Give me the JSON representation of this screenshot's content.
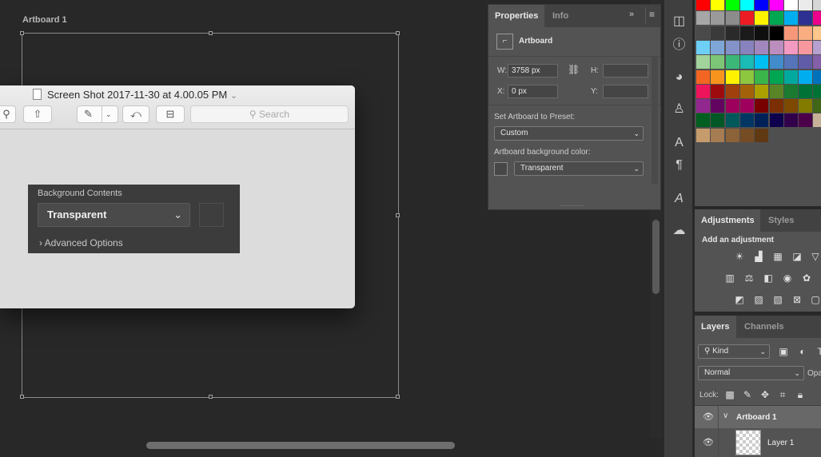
{
  "canvas": {
    "artboard_label": "Artboard 1",
    "bg_color": "#282828"
  },
  "preview_window": {
    "title": "Screen Shot 2017-11-30 at 4.00.05 PM",
    "title_chevron": "⌄",
    "search_placeholder": "Search",
    "toolbar_icons": [
      "zoom-icon",
      "share-icon",
      "markup-pen-icon",
      "chevron-down-icon",
      "rotate-icon",
      "toolbox-icon"
    ]
  },
  "background_popup": {
    "label": "Background Contents",
    "value": "Transparent",
    "advanced_label": "Advanced Options"
  },
  "properties": {
    "tabs": [
      "Properties",
      "Info"
    ],
    "section_title": "Artboard",
    "w_label": "W:",
    "w_value": "3758 px",
    "h_label": "H:",
    "h_value": "",
    "x_label": "X:",
    "x_value": "0 px",
    "y_label": "Y:",
    "y_value": "",
    "preset_label": "Set Artboard to Preset:",
    "preset_value": "Custom",
    "bg_color_label": "Artboard background color:",
    "bg_color_value": "Transparent"
  },
  "adjustments": {
    "tabs": [
      "Adjustments",
      "Styles"
    ],
    "heading": "Add an adjustment"
  },
  "layers": {
    "tabs": [
      "Layers",
      "Channels"
    ],
    "kind_filter": "Kind",
    "blend_mode": "Normal",
    "opacity_label": "Opa",
    "lock_label": "Lock:",
    "artboard_name": "Artboard 1",
    "layer_name": "Layer 1"
  },
  "swatches": {
    "rows": [
      [
        "#ff0000",
        "#ffff00",
        "#00ff00",
        "#00ffff",
        "#0000ff",
        "#ff00ff",
        "#ffffff",
        "#ebebeb",
        "#d6d6d6"
      ],
      [
        "#a6a6a6",
        "#9a9a9a",
        "#8c8c8c",
        "#ed1c24",
        "#fff200",
        "#00a651",
        "#00aeef",
        "#2e3192",
        "#ec008c"
      ],
      [
        "#4a4a4a",
        "#3a3a3a",
        "#2a2a2a",
        "#1a1a1a",
        "#0f0f0f",
        "#000000",
        "#f7977a",
        "#f9ad81",
        "#fdc68a"
      ],
      [
        "#6dcff6",
        "#7ea7d8",
        "#8393ca",
        "#8882be",
        "#a187be",
        "#bc8dbf",
        "#f49ac2",
        "#f6989d",
        "#b5a0cf"
      ],
      [
        "#a3d39c",
        "#7cc576",
        "#3bb878",
        "#1abbb4",
        "#00bff3",
        "#438ccb",
        "#5574b9",
        "#605ca8",
        "#855fa8"
      ],
      [
        "#f26522",
        "#f7941d",
        "#fff200",
        "#8dc63f",
        "#39b54a",
        "#00a651",
        "#00a99d",
        "#00aeef",
        "#0072bc"
      ],
      [
        "#ed145b",
        "#9e0b0f",
        "#a0410d",
        "#a3620a",
        "#aba000",
        "#598527",
        "#1a7b30",
        "#007236",
        "#007236"
      ],
      [
        "#92278f",
        "#630460",
        "#9e005d",
        "#a0005d",
        "#790000",
        "#7b2e00",
        "#7d4900",
        "#827b00",
        "#406618"
      ],
      [
        "#005e20",
        "#005826",
        "#00585b",
        "#003663",
        "#002157",
        "#0d004c",
        "#32004b",
        "#4b0049",
        "#c7b299"
      ],
      [
        "#c69c6d",
        "#a67c52",
        "#8c6239",
        "#754c24",
        "#603913",
        "",
        "",
        "",
        ""
      ]
    ]
  }
}
